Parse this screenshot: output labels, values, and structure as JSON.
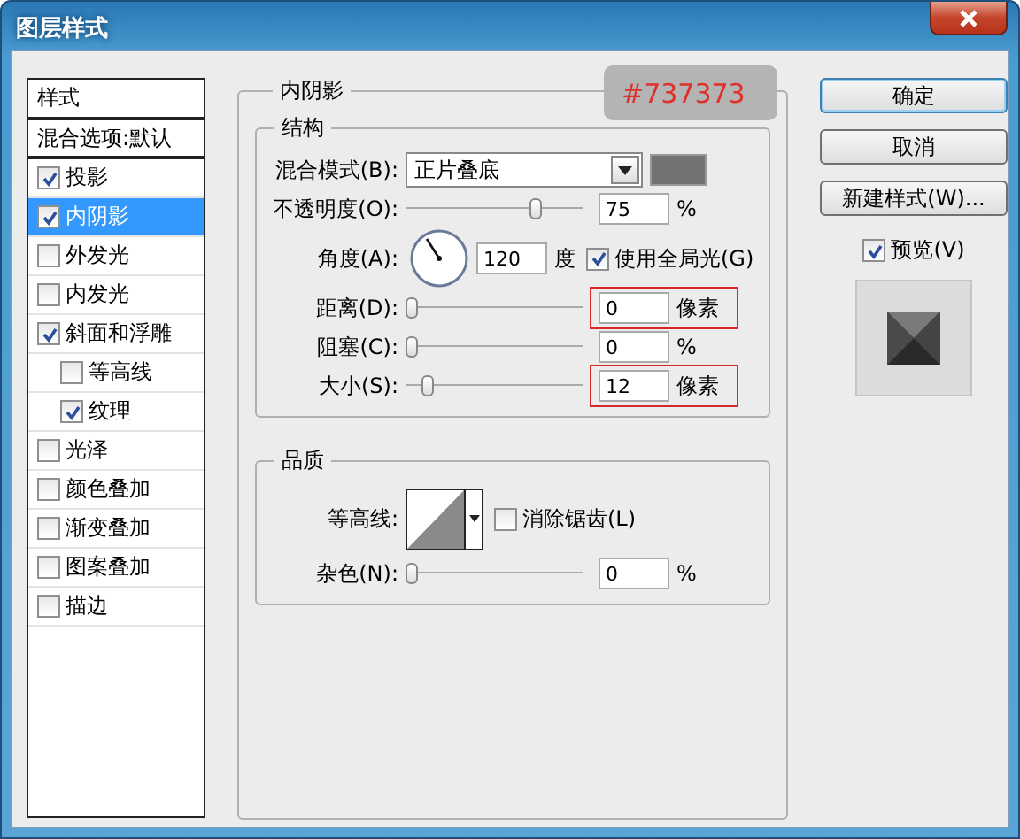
{
  "window": {
    "title": "图层样式"
  },
  "styles_list": {
    "header": "样式",
    "items": [
      {
        "label": "混合选项:默认",
        "kind": "plain",
        "selected": false
      },
      {
        "label": "投影",
        "kind": "check",
        "checked": true,
        "selected": false
      },
      {
        "label": "内阴影",
        "kind": "check",
        "checked": true,
        "selected": true
      },
      {
        "label": "外发光",
        "kind": "check",
        "checked": false,
        "selected": false
      },
      {
        "label": "内发光",
        "kind": "check",
        "checked": false,
        "selected": false
      },
      {
        "label": "斜面和浮雕",
        "kind": "check",
        "checked": true,
        "selected": false,
        "children": [
          {
            "label": "等高线",
            "kind": "check",
            "checked": false,
            "selected": false
          },
          {
            "label": "纹理",
            "kind": "check",
            "checked": true,
            "selected": false
          }
        ]
      },
      {
        "label": "光泽",
        "kind": "check",
        "checked": false,
        "selected": false
      },
      {
        "label": "颜色叠加",
        "kind": "check",
        "checked": false,
        "selected": false
      },
      {
        "label": "渐变叠加",
        "kind": "check",
        "checked": false,
        "selected": false
      },
      {
        "label": "图案叠加",
        "kind": "check",
        "checked": false,
        "selected": false
      },
      {
        "label": "描边",
        "kind": "check",
        "checked": false,
        "selected": false
      }
    ]
  },
  "panel": {
    "title": "内阴影",
    "structure": {
      "title": "结构",
      "rows": [
        {
          "kind": "select",
          "label": "混合模式(B):",
          "value": "正片叠底",
          "color": "#737373"
        },
        {
          "kind": "slider",
          "label": "不透明度(O):",
          "level": 0.75,
          "value": "75",
          "unit": "%",
          "highlighted": false
        },
        {
          "kind": "angle",
          "label": "角度(A):",
          "value": "120",
          "unit": "度",
          "checkbox": {
            "label": "使用全局光(G)",
            "checked": true
          }
        },
        {
          "kind": "slider",
          "label": "距离(D):",
          "level": 0,
          "value": "0",
          "unit": "像素",
          "highlighted": true
        },
        {
          "kind": "slider",
          "label": "阻塞(C):",
          "level": 0,
          "value": "0",
          "unit": "%",
          "highlighted": false
        },
        {
          "kind": "slider",
          "label": "大小(S):",
          "level": 0.1,
          "value": "12",
          "unit": "像素",
          "highlighted": true
        }
      ]
    },
    "quality": {
      "title": "品质",
      "rows": [
        {
          "kind": "contour",
          "label": "等高线:",
          "checkbox": {
            "label": "消除锯齿(L)",
            "checked": false
          }
        },
        {
          "kind": "slider",
          "label": "杂色(N):",
          "level": 0,
          "value": "0",
          "unit": "%",
          "highlighted": false
        }
      ]
    }
  },
  "annotation": {
    "text": "#737373"
  },
  "buttons": [
    {
      "label": "确定",
      "default": true
    },
    {
      "label": "取消",
      "default": false
    },
    {
      "label": "新建样式(W)...",
      "default": false
    }
  ],
  "preview": {
    "label": "预览(V)",
    "checked": true
  }
}
